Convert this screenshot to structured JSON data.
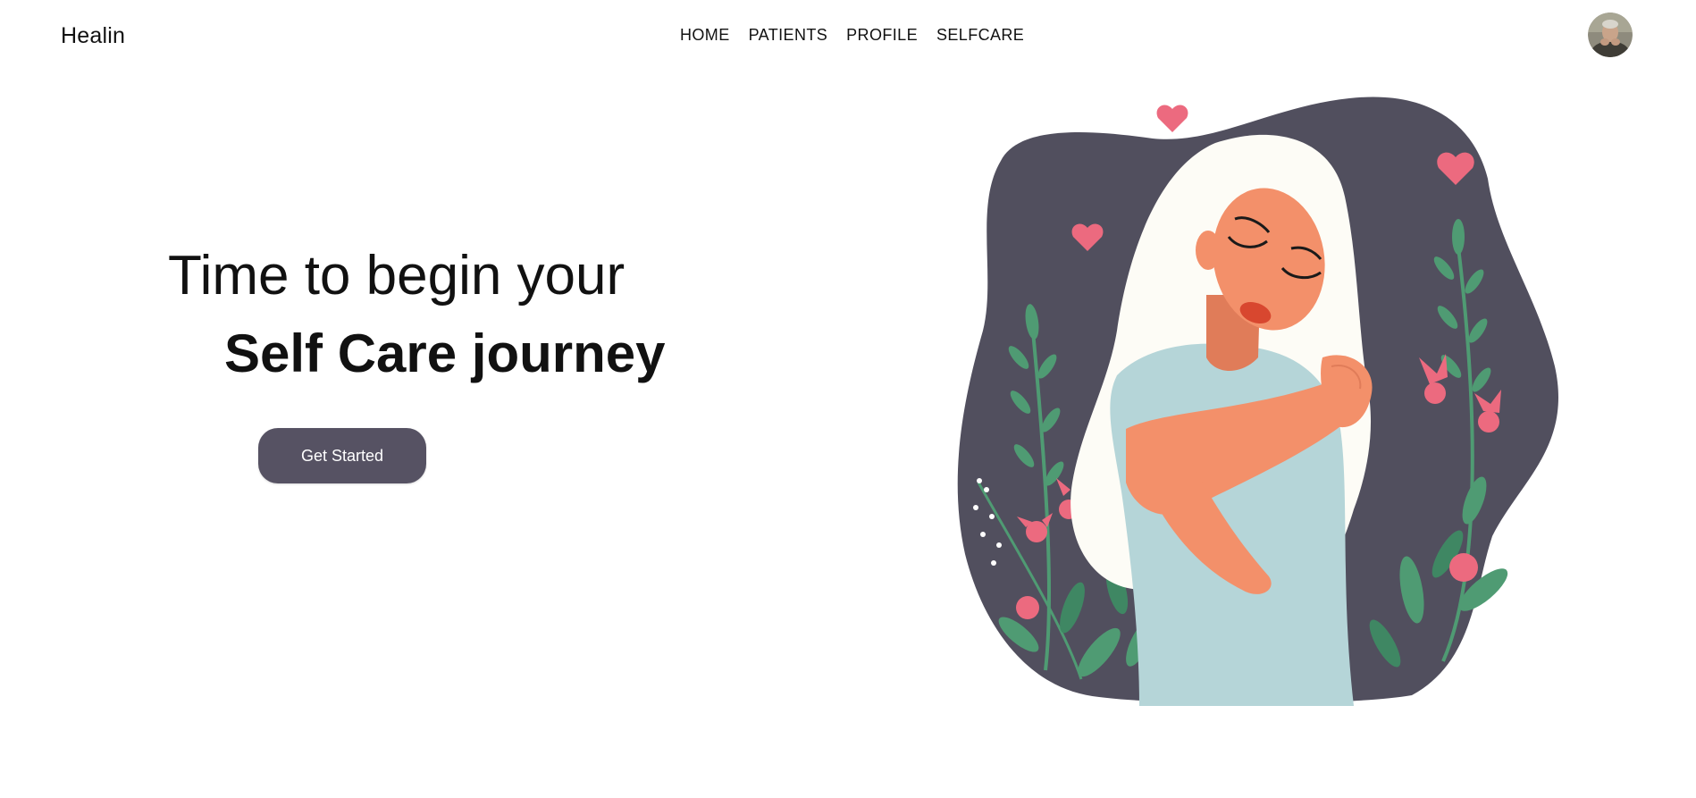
{
  "header": {
    "brand": "Healin",
    "nav": [
      {
        "label": "HOME"
      },
      {
        "label": "PATIENTS"
      },
      {
        "label": "PROFILE"
      },
      {
        "label": "SELFCARE"
      }
    ]
  },
  "hero": {
    "line1": "Time to begin your",
    "line2": "Self Care journey",
    "cta_label": "Get Started"
  },
  "colors": {
    "accent": "#565263",
    "blob": "#514f5e",
    "heart": "#ec6a7f",
    "skin": "#f3906a",
    "shirt": "#b5d5d8",
    "hair": "#fdfcf6",
    "leaf": "#4f9b73"
  }
}
